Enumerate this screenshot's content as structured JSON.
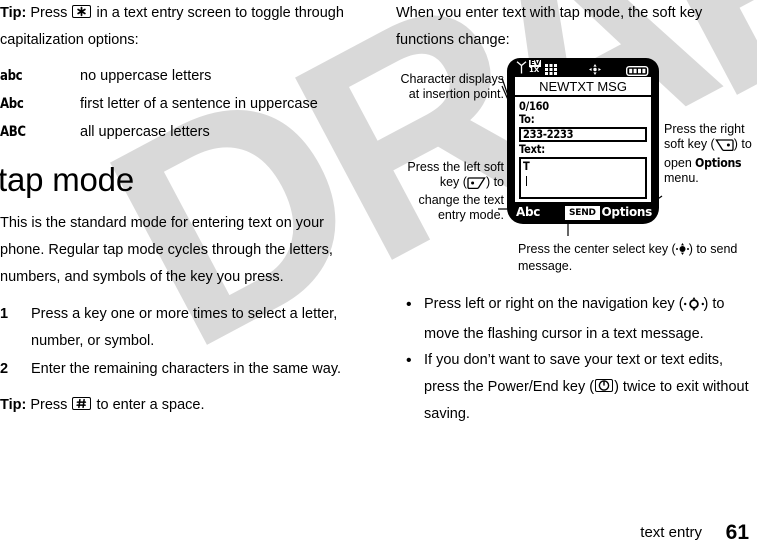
{
  "document": {
    "footer_section": "text entry",
    "page_number": "61",
    "watermark": "DRAFT"
  },
  "left_column": {
    "tip_top": {
      "label": "Tip:",
      "text_before_key": " Press ",
      "key_icon": "asterisk-key-icon",
      "text_after_key": " in a text entry screen to toggle through capitalization options:"
    },
    "capitalization_table": [
      {
        "key": "abc",
        "description": "no uppercase letters"
      },
      {
        "key": "Abc",
        "description": "first letter of a sentence in uppercase"
      },
      {
        "key": "ABC",
        "description": "all uppercase letters"
      }
    ],
    "heading": "tap mode",
    "intro": "This is the standard mode for entering text on your phone. Regular tap mode cycles through the letters, numbers, and symbols of the key you press.",
    "steps": [
      {
        "number": "1",
        "text": "Press a key one or more times to select a letter, number, or symbol."
      },
      {
        "number": "2",
        "text": "Enter the remaining characters in the same way."
      }
    ],
    "tip_bottom": {
      "label": "Tip:",
      "text_before_key": " Press ",
      "key_icon": "pound-key-icon",
      "text_after_key": " to enter a space."
    }
  },
  "right_column": {
    "intro": "When you enter text with tap mode, the soft key functions change:",
    "phone": {
      "status_bar": {
        "signal_icon": "signal-strength-icon",
        "network_icon": "ev-1x-network-icon",
        "network_label_top": "EV",
        "network_label_bottom": "1X",
        "bars_icon": "signal-bars-icon",
        "location_icon": "location-compass-icon",
        "battery_icon": "battery-icon"
      },
      "screen_title": "NEWTXT MSG",
      "char_count": "0/160",
      "to_label": "To:",
      "to_value": "233-2233",
      "text_label": "Text:",
      "text_value": "T",
      "softkey_left": "Abc",
      "softkey_center": "SEND",
      "softkey_right": "Options"
    },
    "callouts": {
      "character": "Character displays at insertion point.",
      "left_soft_key_part1": "Press the left soft key (",
      "left_soft_key_icon": "left-soft-key-icon",
      "left_soft_key_part2": ") to change the text entry mode.",
      "right_soft_key_part1": "Press the right soft key (",
      "right_soft_key_icon": "right-soft-key-icon",
      "right_soft_key_part2": ") to open ",
      "right_soft_key_bold": "Options",
      "right_soft_key_part3": " menu.",
      "center_select_part1": "Press the center select key (",
      "center_select_icon": "center-select-key-icon",
      "center_select_part2": ") to send message."
    },
    "bullets": [
      {
        "text_part1": "Press left or right on the navigation key (",
        "icon": "navigation-key-icon",
        "text_part2": ") to move the flashing cursor in a text message."
      },
      {
        "text_part1": "If you don’t want to save your text or text edits, press the Power/End key (",
        "icon": "power-end-key-icon",
        "text_part2": ") twice to exit without saving."
      }
    ]
  },
  "colors": {
    "ink": "#000000",
    "paper": "#ffffff",
    "watermark": "#d9d9d9"
  }
}
